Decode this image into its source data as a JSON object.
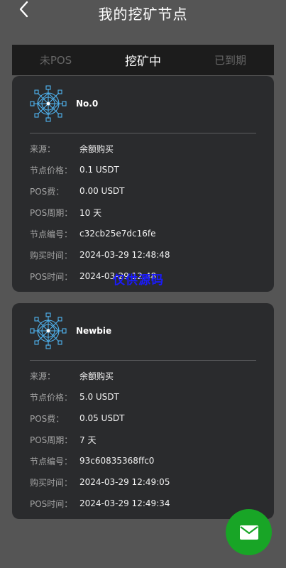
{
  "header": {
    "title": "我的挖矿节点"
  },
  "tabs": [
    {
      "label": "未POS",
      "active": false
    },
    {
      "label": "挖矿中",
      "active": true
    },
    {
      "label": "已到期",
      "active": false
    }
  ],
  "cards": [
    {
      "name": "No.0",
      "rows": [
        {
          "label": "来源：",
          "value": "余额购买"
        },
        {
          "label": "节点价格：",
          "value": "0.1 USDT"
        },
        {
          "label": "POS费：",
          "value": "0.00 USDT"
        },
        {
          "label": "POS周期：",
          "value": "10 天"
        },
        {
          "label": "节点编号：",
          "value": "c32cb25e7dc16fe"
        },
        {
          "label": "购买时间：",
          "value": "2024-03-29 12:48:48"
        },
        {
          "label": "POS时间：",
          "value": "2024-03-29 12:48"
        }
      ]
    },
    {
      "name": "Newbie",
      "rows": [
        {
          "label": "来源：",
          "value": "余额购买"
        },
        {
          "label": "节点价格：",
          "value": "5.0 USDT"
        },
        {
          "label": "POS费：",
          "value": "0.05 USDT"
        },
        {
          "label": "POS周期：",
          "value": "7 天"
        },
        {
          "label": "节点编号：",
          "value": "93c60835368ffc0"
        },
        {
          "label": "购买时间：",
          "value": "2024-03-29 12:49:05"
        },
        {
          "label": "POS时间：",
          "value": "2024-03-29 12:49:34"
        }
      ]
    }
  ],
  "watermark": "仅供源码",
  "colors": {
    "accent": "#18a526",
    "card": "#2a2b2d",
    "background": "#555555",
    "icon": "#4fb3f0"
  }
}
